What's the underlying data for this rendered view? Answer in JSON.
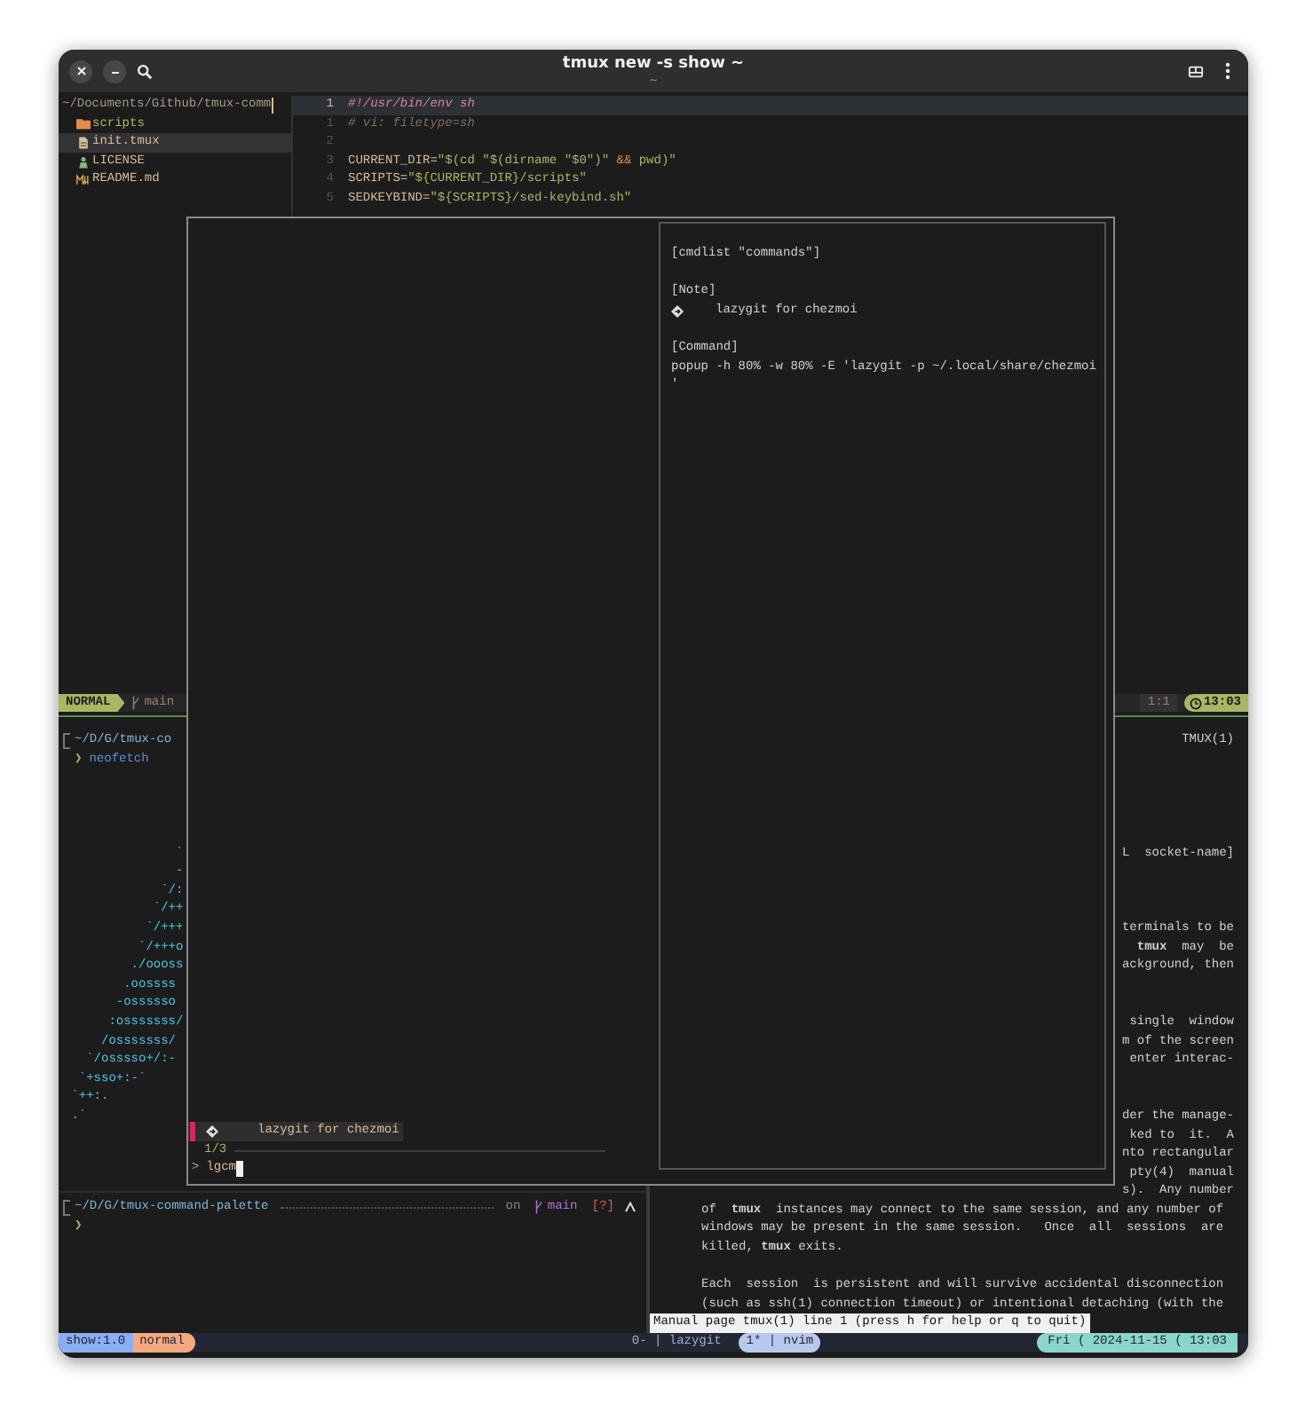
{
  "window": {
    "title": "tmux new -s show ~",
    "subtitle": "~"
  },
  "file_tree": {
    "path": "~/Documents/Github/tmux-comm",
    "items": [
      {
        "name": "scripts",
        "kind": "folder",
        "selected": false
      },
      {
        "name": "init.tmux",
        "kind": "file",
        "selected": true
      },
      {
        "name": "LICENSE",
        "kind": "license",
        "selected": false
      },
      {
        "name": "README.md",
        "kind": "markdown",
        "selected": false
      }
    ]
  },
  "editor": {
    "lines": [
      {
        "number": "1",
        "current": true,
        "segments": [
          {
            "text": "#!/usr/bin/env sh",
            "kind": "shebang"
          }
        ]
      },
      {
        "number": "1",
        "current": false,
        "segments": [
          {
            "text": "# vi: filetype=sh",
            "kind": "comment"
          }
        ]
      },
      {
        "number": "2",
        "current": false
      },
      {
        "number": "3",
        "current": false,
        "segments": [
          {
            "text": "CURRENT_DIR=",
            "kind": "ident"
          },
          {
            "text": "\"$(cd \"$(dirname \"$0\")\" ",
            "kind": "string"
          },
          {
            "text": "&&",
            "kind": "operator"
          },
          {
            "text": " pwd)\"",
            "kind": "string"
          }
        ]
      },
      {
        "number": "4",
        "current": false,
        "segments": [
          {
            "text": "SCRIPTS=",
            "kind": "ident"
          },
          {
            "text": "\"${CURRENT_DIR}/scripts\"",
            "kind": "string"
          }
        ]
      },
      {
        "number": "5",
        "current": false,
        "segments": [
          {
            "text": "SEDKEYBIND=",
            "kind": "ident"
          },
          {
            "text": "\"${SCRIPTS}/sed-keybind.sh\"",
            "kind": "string"
          }
        ]
      }
    ]
  },
  "statusline": {
    "mode": "NORMAL",
    "branch": "main",
    "position": "1:1",
    "time": "13:03"
  },
  "shell_top": {
    "path": "~/D/G/tmux-co",
    "prompt_symbol": "❯",
    "command": "neofetch",
    "logo": [
      "               `",
      "               -",
      "             `/:",
      "            `/++",
      "           `/+++",
      "          `/+++o",
      "         ./oooss",
      "        .oossss",
      "       -ossssso",
      "      :osssssss/",
      "     /osssssss/",
      "   `/osssso+/:-",
      "  `+sso+:-`",
      " `++:.",
      " .`"
    ]
  },
  "shell_bottom": {
    "path": "~/D/G/tmux-command-palette",
    "on": "on",
    "branch": "main",
    "status": "[?]",
    "prompt_symbol": "❯"
  },
  "man": {
    "header": "TMUX(1)",
    "fragment_groups": [
      [
        "L  socket-name]"
      ],
      [
        "terminals to be",
        "**tmux**  may  be",
        "ackground, then"
      ],
      [
        "single  window",
        "m of the screen",
        "enter interac-"
      ],
      [
        "der the manage-",
        "ked to  it.  A",
        "nto rectangular",
        "pty(4)  manual",
        "s).  Any number"
      ]
    ],
    "paragraphs": [
      [
        "of  **tmux**  instances may connect to the same session, and any number of",
        "windows may be present in the same session.   Once  all  sessions  are",
        "killed, **tmux** exits."
      ],
      [
        "Each  session  is persistent and will survive accidental disconnection",
        "(such as ssh(1) connection timeout) or intentional detaching (with the"
      ]
    ],
    "prompt": "Manual page tmux(1) line 1 (press h for help or q to quit)"
  },
  "popup": {
    "items": [
      {
        "label": "lazygit for chezmoi",
        "selected": true
      }
    ],
    "counter": "1/3",
    "prompt": ">",
    "query": "lgcm",
    "preview": {
      "title": "[cmdlist \"commands\"]",
      "note_heading": "[Note]",
      "note": "lazygit for chezmoi",
      "command_heading": "[Command]",
      "command_lines": [
        "popup -h 80% -w 80% -E 'lazygit -p ~/.local/share/chezmoi",
        "'"
      ]
    }
  },
  "tmux_bar": {
    "session": "show:1.0",
    "mode": "normal",
    "windows": [
      {
        "label": "0- | lazygit",
        "selected": false
      },
      {
        "label": "1* | nvim",
        "selected": true
      }
    ],
    "clock": "Fri ( 2024-11-15 ( 13:03"
  }
}
